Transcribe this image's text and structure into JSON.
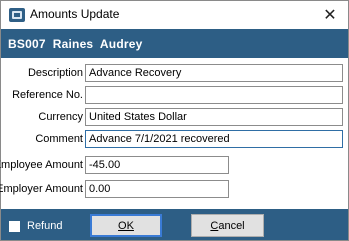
{
  "window": {
    "title": "Amounts Update",
    "close_icon": "✕"
  },
  "banner": {
    "text": "BS007  Raines  Audrey"
  },
  "fields": [
    {
      "label": "Description",
      "value": "Advance Recovery"
    },
    {
      "label": "Reference No.",
      "value": ""
    },
    {
      "label": "Currency",
      "value": "United States Dollar"
    },
    {
      "label": "Comment",
      "value": "Advance 7/1/2021 recovered"
    },
    {
      "label": "Employee Amount",
      "value": "-45.00"
    },
    {
      "label": "Employer Amount",
      "value": "0.00"
    }
  ],
  "footer": {
    "refund_label": "Refund",
    "refund_checked": false,
    "ok_label": "OK",
    "cancel_first": "C",
    "cancel_rest": "ancel"
  },
  "colors": {
    "banner": "#2d5e85",
    "accent": "#3a7bd5"
  }
}
